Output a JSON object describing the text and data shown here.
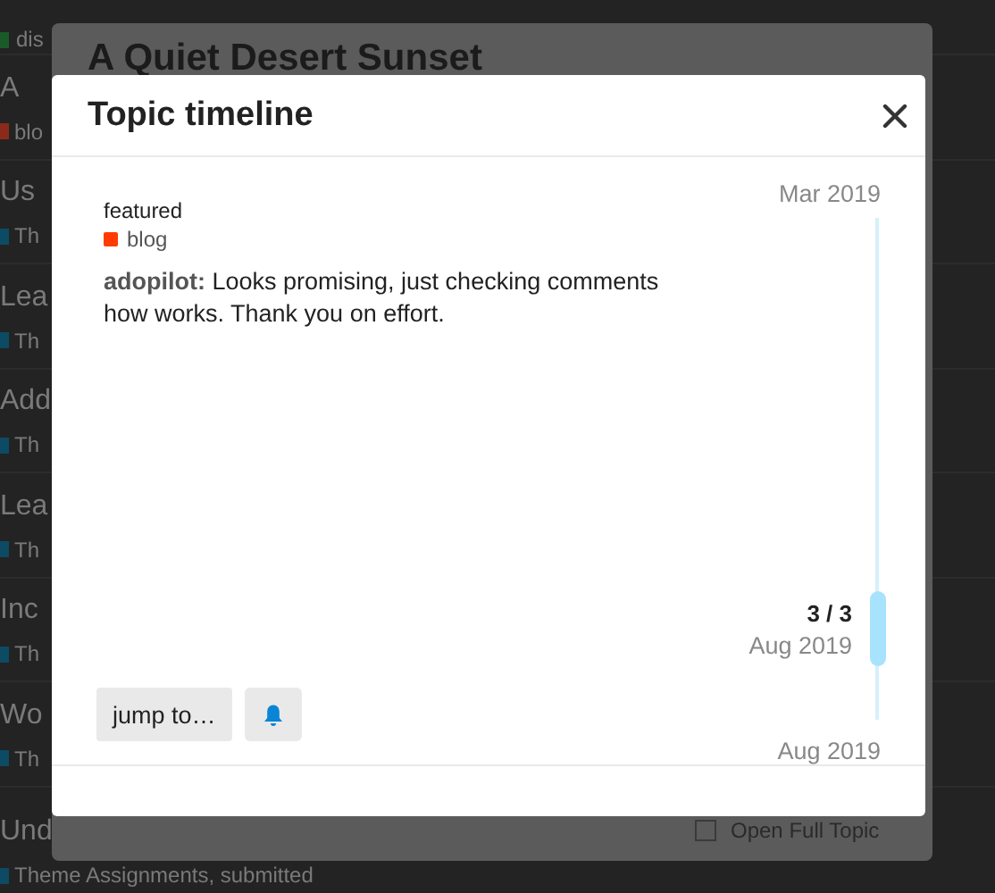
{
  "background_list": [
    {
      "title": "A",
      "tag": {
        "label": "blo",
        "color": "#8b2a1a"
      }
    },
    {
      "title": "Us",
      "tag": {
        "label": "Th",
        "color": "#0d4a63"
      }
    },
    {
      "title": "Lea",
      "tag": {
        "label": "Th",
        "color": "#0d4a63"
      }
    },
    {
      "title": "Add",
      "tag": {
        "label": "Th",
        "color": "#0d4a63"
      }
    },
    {
      "title": "Lea",
      "tag": {
        "label": "Th",
        "color": "#0d4a63"
      }
    },
    {
      "title": "Inc",
      "tag": {
        "label": "Th",
        "color": "#0d4a63"
      }
    },
    {
      "title": "Wo",
      "tag": {
        "label": "Th",
        "color": "#0d4a63"
      }
    },
    {
      "title": "Und",
      "tag": {
        "label": "Theme Assignments, submitted",
        "color": "#0d4a63"
      }
    }
  ],
  "top_tag": {
    "label": "dis",
    "color": "#1a5a2a"
  },
  "back_modal": {
    "title": "A Quiet Desert Sunset",
    "footer_checkbox": {
      "label": "Open Full Topic",
      "checked": false
    }
  },
  "modal": {
    "title": "Topic timeline",
    "post": {
      "status": "featured",
      "category": {
        "label": "blog",
        "color": "#ff3c00"
      },
      "author": "adopilot:",
      "excerpt": "Looks promising, just checking comments how works. Thank you on effort."
    },
    "timeline": {
      "start_date": "Mar 2019",
      "position": "3 / 3",
      "position_date": "Aug 2019",
      "end_date": "Aug 2019"
    },
    "jump_button": "jump to…"
  }
}
